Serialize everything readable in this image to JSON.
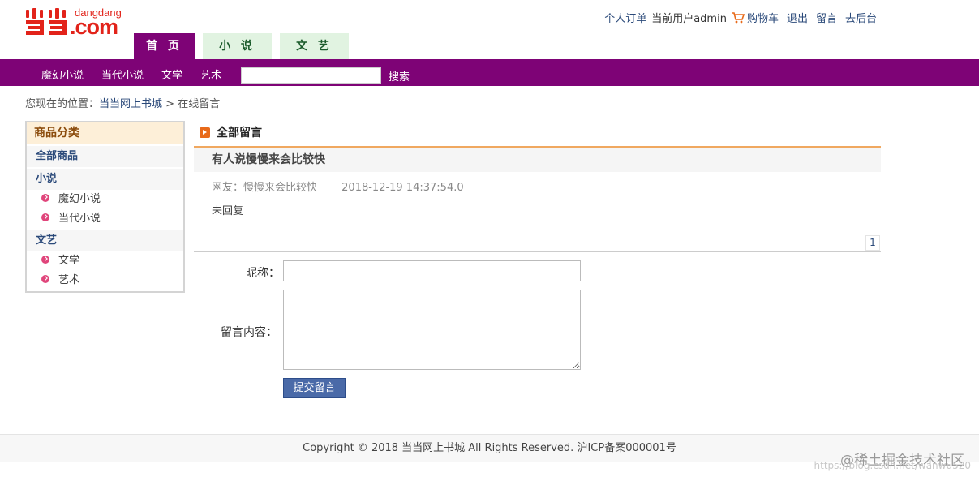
{
  "logo": {
    "sub": "dangdang",
    "main": ".com"
  },
  "toplinks": {
    "orders": "个人订单",
    "user": "当前用户admin",
    "cart": "购物车",
    "logout": "退出",
    "message": "留言",
    "admin": "去后台"
  },
  "tabs": [
    {
      "label": "首 页"
    },
    {
      "label": "小 说"
    },
    {
      "label": "文 艺"
    }
  ],
  "navbar": {
    "categories": [
      "魔幻小说",
      "当代小说",
      "文学",
      "艺术"
    ],
    "search_value": "",
    "search_label": "搜索"
  },
  "breadcrumb": {
    "prefix": "您现在的位置：",
    "home": "当当网上书城",
    "sep": ">",
    "current": "在线留言"
  },
  "sidebar": {
    "title": "商品分类",
    "all": "全部商品",
    "group1": "小说",
    "group1_items": [
      "魔幻小说",
      "当代小说"
    ],
    "group2": "文艺",
    "group2_items": [
      "文学",
      "艺术"
    ]
  },
  "main": {
    "title": "全部留言",
    "message": {
      "title": "有人说慢慢来会比较快",
      "author": "网友：慢慢来会比较快",
      "time": "2018-12-19 14:37:54.0",
      "reply": "未回复"
    },
    "page": "1"
  },
  "form": {
    "nick_label": "昵称：",
    "nick_value": "",
    "content_label": "留言内容：",
    "content_value": "",
    "submit": "提交留言"
  },
  "footer": {
    "text": "Copyright © 2018 当当网上书城 All Rights Reserved. 沪ICP备案000001号"
  },
  "watermark": {
    "text": "@稀土掘金技术社区",
    "url": "https://blog.csdn.net/wanwu520"
  },
  "colors": {
    "brand": "#7e0376",
    "accent": "#e2231a",
    "link": "#2b4a7a"
  }
}
